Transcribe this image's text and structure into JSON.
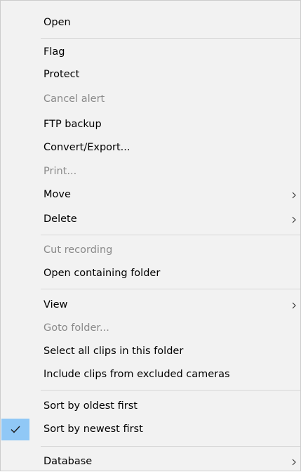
{
  "menu": {
    "items": {
      "open": "Open",
      "flag": "Flag",
      "protect": "Protect",
      "cancel_alert": "Cancel alert",
      "ftp_backup": "FTP backup",
      "convert_export": "Convert/Export...",
      "print": "Print...",
      "move": "Move",
      "delete": "Delete",
      "cut_recording": "Cut recording",
      "open_containing_folder": "Open containing folder",
      "view": "View",
      "goto_folder": "Goto folder...",
      "select_all_clips": "Select all clips in this folder",
      "include_clips_excluded": "Include clips from excluded cameras",
      "sort_oldest_first": "Sort by oldest first",
      "sort_newest_first": "Sort by newest first",
      "database": "Database"
    },
    "disabled": [
      "Cancel alert",
      "Print...",
      "Cut recording",
      "Goto folder..."
    ],
    "submenus": [
      "Move",
      "Delete",
      "View",
      "Database"
    ],
    "checked": "Sort by newest first",
    "colors": {
      "background": "#f2f2f2",
      "border": "#cccccc",
      "disabled_text": "#8a8a8a",
      "separator": "#d7d7d7",
      "check_highlight": "#90c8f6"
    },
    "icons": {
      "check": "checkmark-icon",
      "submenu": "chevron-right-icon"
    }
  }
}
